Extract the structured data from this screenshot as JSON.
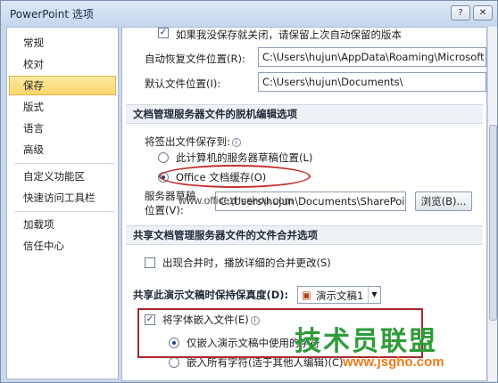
{
  "window": {
    "title": "PowerPoint 选项",
    "help_label": "?",
    "close_label": "✕"
  },
  "nav": {
    "items": [
      {
        "label": "常规"
      },
      {
        "label": "校对"
      },
      {
        "label": "保存"
      },
      {
        "label": "版式"
      },
      {
        "label": "语言"
      },
      {
        "label": "高级"
      },
      {
        "label": "自定义功能区"
      },
      {
        "label": "快速访问工具栏"
      },
      {
        "label": "加载项"
      },
      {
        "label": "信任中心"
      }
    ],
    "selected": "保存"
  },
  "save": {
    "autorecover_keep_label": "如果我没保存就关闭，请保留上次自动保留的版本",
    "autorecover_location_label": "自动恢复文件位置(R):",
    "autorecover_location_value": "C:\\Users\\hujun\\AppData\\Roaming\\Microsoft",
    "default_location_label": "默认文件位置(I):",
    "default_location_value": "C:\\Users\\hujun\\Documents\\"
  },
  "offline": {
    "section_title": "文档管理服务器文件的脱机编辑选项",
    "save_checkout_label": "将签出文件保存到:",
    "option_drafts": "此计算机的服务器草稿位置(L)",
    "option_cache": "Office 文档缓存(O)",
    "server_drafts_label": "服务器草稿",
    "server_drafts_label2": "位置(V):",
    "server_drafts_value": "C:\\Users\\hujun\\Documents\\SharePoint 草稿",
    "browse_label": "浏览(B)..."
  },
  "merge": {
    "section_title": "共享文档管理服务器文件的文件合并选项",
    "show_merge_label": "出现合并时，播放详细的合并更改(S)"
  },
  "fidelity": {
    "section_title": "共享此演示文稿时保持保真度(D):",
    "presentation_value": "演示文稿1",
    "embed_fonts_label": "将字体嵌入文件(E)",
    "embed_used_label": "仅嵌入演示文稿中使用的字符",
    "embed_all_label": "嵌入所有字符(适于其他人编辑)(C)"
  },
  "watermarks": {
    "wm1": "www.officezhushou.com",
    "wm2": "技术员联盟",
    "wm3": "www.jsgho.com"
  },
  "colors": {
    "accent": "#fbd66a",
    "annotation_red": "#a8292a",
    "watermark_green": "#2e9c3a"
  }
}
